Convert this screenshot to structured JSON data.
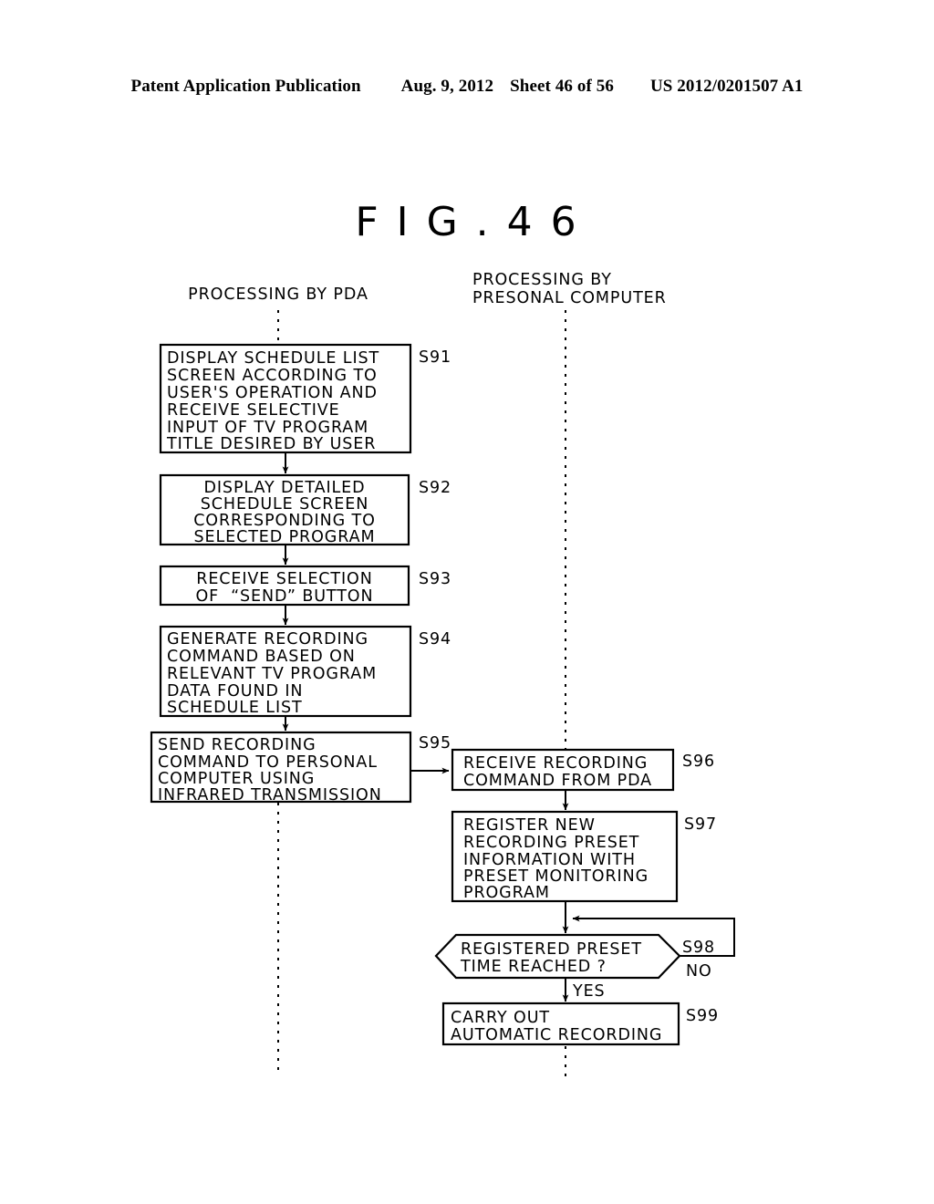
{
  "header": {
    "publication": "Patent Application Publication",
    "date": "Aug. 9, 2012",
    "sheet": "Sheet 46 of 56",
    "number": "US 2012/0201507 A1"
  },
  "figure": {
    "title": "F I G . 4 6"
  },
  "lanes": [
    {
      "id": "pda",
      "label": "PROCESSING BY PDA"
    },
    {
      "id": "pc",
      "label_line1": "PROCESSING BY",
      "label_line2": "PRESONAL COMPUTER"
    }
  ],
  "steps": [
    {
      "id": "S91",
      "lane": "pda",
      "shape": "process",
      "align": "left",
      "lines": [
        "DISPLAY SCHEDULE LIST",
        "SCREEN ACCORDING TO",
        "USER'S OPERATION AND",
        "RECEIVE SELECTIVE",
        "INPUT OF TV PROGRAM",
        "TITLE DESIRED BY USER"
      ]
    },
    {
      "id": "S92",
      "lane": "pda",
      "shape": "process",
      "align": "center",
      "lines": [
        "DISPLAY DETAILED",
        "SCHEDULE SCREEN",
        "CORRESPONDING TO",
        "SELECTED PROGRAM"
      ]
    },
    {
      "id": "S93",
      "lane": "pda",
      "shape": "process",
      "align": "center",
      "lines": [
        "RECEIVE SELECTION",
        "OF  “SEND” BUTTON"
      ]
    },
    {
      "id": "S94",
      "lane": "pda",
      "shape": "process",
      "align": "left",
      "lines": [
        "GENERATE RECORDING",
        "COMMAND BASED ON",
        "RELEVANT TV PROGRAM",
        "DATA FOUND IN",
        "SCHEDULE LIST"
      ]
    },
    {
      "id": "S95",
      "lane": "pda",
      "shape": "process",
      "align": "left",
      "lines": [
        "SEND RECORDING",
        "COMMAND TO PERSONAL",
        "COMPUTER USING",
        "INFRARED TRANSMISSION"
      ]
    },
    {
      "id": "S96",
      "lane": "pc",
      "shape": "process",
      "align": "left",
      "lines": [
        "RECEIVE RECORDING",
        "COMMAND FROM PDA"
      ]
    },
    {
      "id": "S97",
      "lane": "pc",
      "shape": "process",
      "align": "left",
      "lines": [
        "REGISTER NEW",
        "RECORDING PRESET",
        "INFORMATION WITH",
        "PRESET MONITORING",
        "PROGRAM"
      ]
    },
    {
      "id": "S98",
      "lane": "pc",
      "shape": "decision",
      "align": "left",
      "lines": [
        "REGISTERED PRESET",
        "TIME REACHED ?"
      ]
    },
    {
      "id": "S99",
      "lane": "pc",
      "shape": "process",
      "align": "left",
      "lines": [
        "CARRY OUT",
        "AUTOMATIC RECORDING"
      ]
    }
  ],
  "branches": [
    {
      "from": "S98",
      "label": "YES",
      "to": "S99"
    },
    {
      "from": "S98",
      "label": "NO",
      "to": "S98"
    }
  ]
}
